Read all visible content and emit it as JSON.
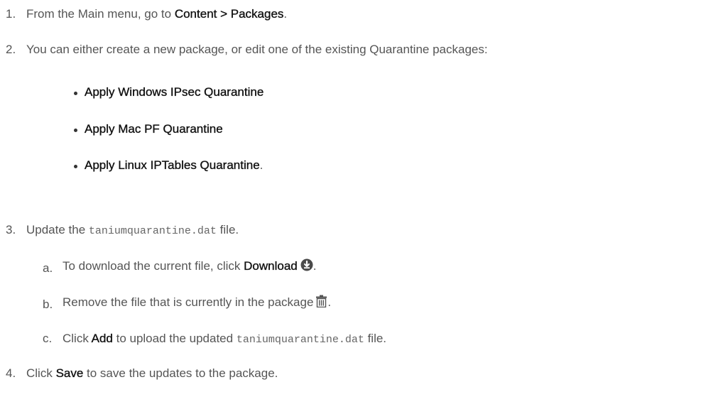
{
  "steps": [
    {
      "number": "1.",
      "prefix": "From the Main menu, go to ",
      "bold": "Content > Packages",
      "suffix": "."
    },
    {
      "number": "2.",
      "text": "You can either create a new package, or edit one of the existing Quarantine packages:",
      "bullets": [
        {
          "bold": "Apply Windows IPsec Quarantine",
          "suffix": ""
        },
        {
          "bold": "Apply Mac PF Quarantine",
          "suffix": ""
        },
        {
          "bold": "Apply Linux IPTables Quarantine",
          "suffix": "."
        }
      ]
    },
    {
      "number": "3.",
      "prefix": "Update the ",
      "code": "taniumquarantine.dat",
      "suffix": " file.",
      "substeps": [
        {
          "letter": "a.",
          "prefix": "To download the current file, click ",
          "bold": "Download",
          "icon": "download-icon",
          "suffix": "."
        },
        {
          "letter": "b.",
          "prefix": "Remove the file that is currently in the package",
          "icon": "trash-icon",
          "suffix": "."
        },
        {
          "letter": "c.",
          "prefix": "Click ",
          "bold": "Add",
          "middle": " to upload the updated ",
          "code": "taniumquarantine.dat",
          "suffix": " file."
        }
      ]
    },
    {
      "number": "4.",
      "prefix": "Click ",
      "bold": "Save",
      "suffix": " to save the updates to the package."
    }
  ]
}
